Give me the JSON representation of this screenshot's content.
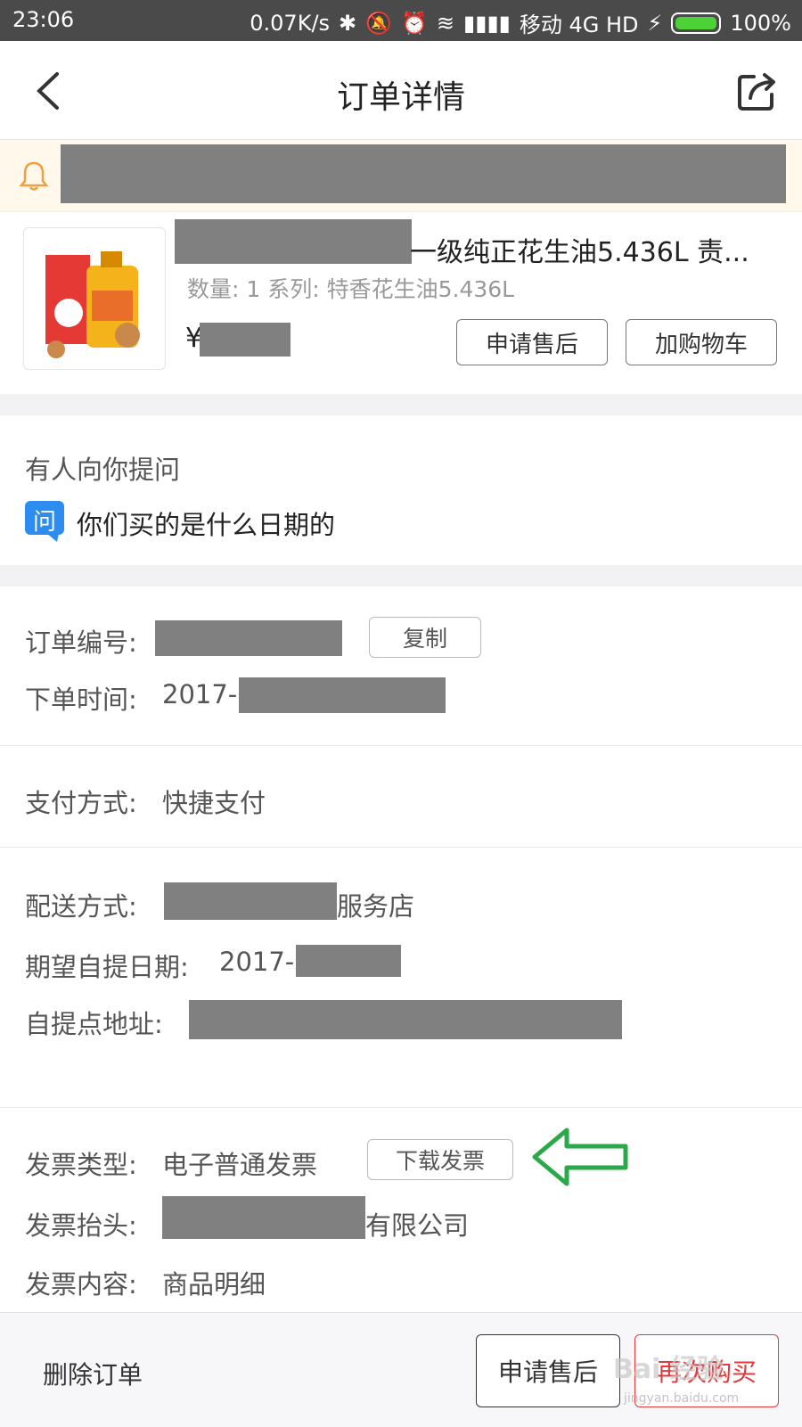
{
  "status": {
    "time": "23:06",
    "speed": "0.07K/s",
    "carrier": "移动 4G HD",
    "battery": "100%",
    "battery_level": 1.0
  },
  "header": {
    "title": "订单详情",
    "back_icon": "chevron-left-icon",
    "share_icon": "share-icon"
  },
  "notice": {
    "icon": "bell-icon",
    "accent": "#f0a040"
  },
  "product": {
    "title_visible": "一级纯正花生油5.436L 责...",
    "spec": "数量: 1 系列: 特香花生油5.436L",
    "currency": "¥",
    "after_sale_label": "申请售后",
    "add_cart_label": "加购物车"
  },
  "question": {
    "heading": "有人向你提问",
    "badge": "问",
    "text": "你们买的是什么日期的",
    "badge_color": "#2d8cf0"
  },
  "order": {
    "number_label": "订单编号:",
    "copy_label": "复制",
    "time_label": "下单时间:",
    "time_prefix": "2017-"
  },
  "payment": {
    "label": "支付方式:",
    "value": "快捷支付"
  },
  "delivery": {
    "method_label": "配送方式:",
    "method_suffix": "服务店",
    "date_label": "期望自提日期:",
    "date_prefix": "2017-",
    "address_label": "自提点地址:"
  },
  "invoice": {
    "type_label": "发票类型:",
    "type_value": "电子普通发票",
    "download_label": "下载发票",
    "title_label": "发票抬头:",
    "title_suffix": "有限公司",
    "content_label": "发票内容:",
    "content_value": "商品明细",
    "arrow_color": "#2aa84a"
  },
  "footer": {
    "delete_label": "删除订单",
    "after_sale_label": "申请售后",
    "rebuy_label": "再次购买",
    "rebuy_color": "#e4393c"
  },
  "watermark": {
    "text": "Bai 经验",
    "sub": "jingyan.baidu.com"
  }
}
